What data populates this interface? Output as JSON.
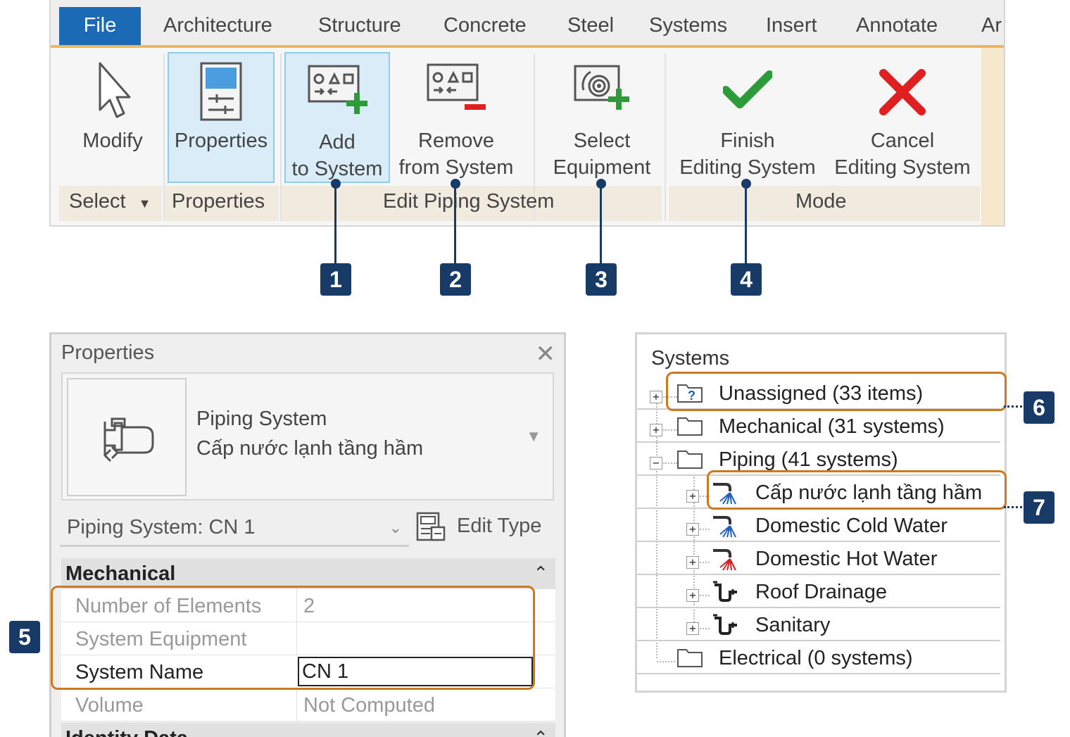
{
  "ribbon": {
    "tabs": [
      "File",
      "Architecture",
      "Structure",
      "Concrete",
      "Steel",
      "Systems",
      "Insert",
      "Annotate",
      "Ar"
    ],
    "buttons": {
      "modify": [
        "Modify"
      ],
      "properties": [
        "Properties"
      ],
      "add_to_system": [
        "Add",
        "to System"
      ],
      "remove_from_system": [
        "Remove",
        "from System"
      ],
      "select_equipment": [
        "Select",
        "Equipment"
      ],
      "finish_editing": [
        "Finish",
        "Editing System"
      ],
      "cancel_editing": [
        "Cancel",
        "Editing System"
      ]
    },
    "groups": {
      "select": "Select",
      "properties": "Properties",
      "edit_piping_system": "Edit Piping System",
      "mode": "Mode"
    },
    "colors": {
      "file_tab": "#1b6ab5",
      "accent": "#f0b45a",
      "finish": "#2e9b3b",
      "cancel": "#e02020"
    }
  },
  "callouts": [
    "1",
    "2",
    "3",
    "4",
    "5",
    "6",
    "7"
  ],
  "properties_panel": {
    "title": "Properties",
    "type_family": "Piping System",
    "type_name": "Cấp nước lạnh tầng hầm",
    "instance_selector": "Piping System: CN 1",
    "edit_type": "Edit Type",
    "sections": [
      "Mechanical",
      "Identity Data"
    ],
    "rows": [
      {
        "key": "Number of Elements",
        "value": "2"
      },
      {
        "key": "System Equipment",
        "value": ""
      },
      {
        "key": "System Name",
        "value": "CN 1"
      },
      {
        "key": "Volume",
        "value": "Not Computed"
      }
    ]
  },
  "systems_browser": {
    "title": "Systems",
    "items": [
      {
        "label": "Unassigned (33 items)",
        "icon": "unassigned-folder-icon"
      },
      {
        "label": "Mechanical (31 systems)",
        "icon": "folder-icon"
      },
      {
        "label": "Piping (41 systems)",
        "icon": "folder-icon"
      },
      {
        "label": "Cấp nước lạnh tầng hầm",
        "icon": "cold-water-system-icon"
      },
      {
        "label": "Domestic Cold Water",
        "icon": "cold-water-system-icon"
      },
      {
        "label": "Domestic Hot Water",
        "icon": "hot-water-system-icon"
      },
      {
        "label": "Roof Drainage",
        "icon": "drainage-system-icon"
      },
      {
        "label": "Sanitary",
        "icon": "drainage-system-icon"
      },
      {
        "label": "Electrical (0 systems)",
        "icon": "folder-icon"
      }
    ]
  }
}
